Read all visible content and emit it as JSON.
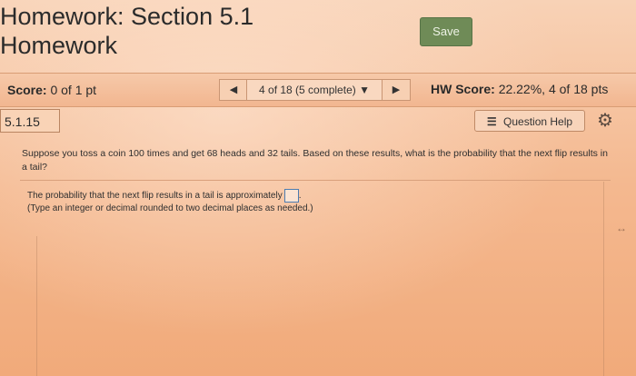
{
  "header": {
    "title_line1": "Homework: Section 5.1",
    "title_line2": "Homework",
    "save_label": "Save"
  },
  "score_bar": {
    "score_label": "Score:",
    "score_value": "0 of 1 pt",
    "nav_prev_icon": "◀",
    "nav_text": "4 of 18 (5 complete)",
    "nav_dropdown_icon": "▼",
    "nav_next_icon": "▶",
    "hw_score_label": "HW Score:",
    "hw_score_value": "22.22%, 4 of 18 pts"
  },
  "question_bar": {
    "number": "5.1.15",
    "help_icon": "☰",
    "help_label": "Question Help",
    "gear_icon": "⚙"
  },
  "question": {
    "text": "Suppose you toss a coin 100 times and get 68 heads and 32 tails. Based on these results, what is the probability that the next flip results in a tail?",
    "answer_prompt": "The probability that the next flip results in a tail is approximately",
    "answer_value": "",
    "answer_suffix": ".",
    "instruction": "(Type an integer or decimal rounded to two decimal places as needed.)"
  },
  "misc": {
    "edge_arrow": "↔"
  }
}
